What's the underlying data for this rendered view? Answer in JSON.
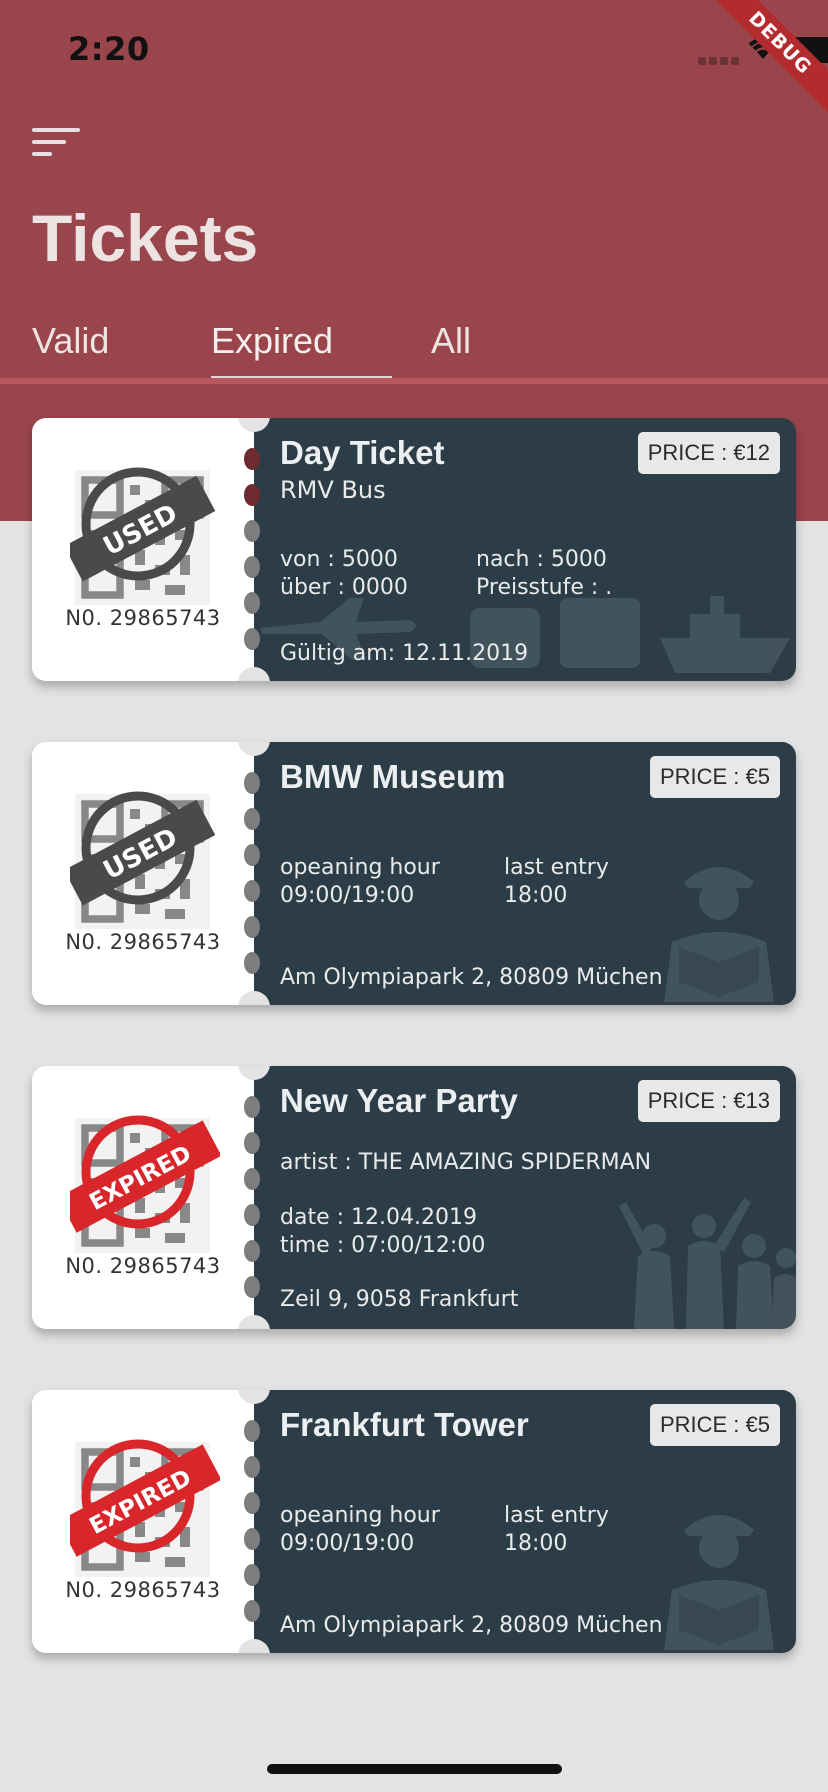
{
  "status": {
    "time": "2:20",
    "debug_label": "DEBUG"
  },
  "header": {
    "title": "Tickets"
  },
  "tabs": [
    {
      "label": "Valid"
    },
    {
      "label": "Expired"
    },
    {
      "label": "All"
    }
  ],
  "active_tab": "Expired",
  "tickets": [
    {
      "stamp": "USED",
      "number": "N0. 29865743",
      "title": "Day Ticket",
      "subtitle": "RMV Bus",
      "price": "PRICE : €12",
      "col1": [
        "von : 5000",
        "über : 0000"
      ],
      "col2": [
        "nach : 5000",
        "Preisstufe : ."
      ],
      "footer": "Gültig am: 12.11.2019"
    },
    {
      "stamp": "USED",
      "number": "N0. 29865743",
      "title": "BMW Museum",
      "price": "PRICE : €5",
      "col1": [
        "opeaning hour",
        "09:00/19:00"
      ],
      "col2": [
        "last entry",
        "18:00"
      ],
      "footer": "Am Olympiapark 2, 80809 Müchen"
    },
    {
      "stamp": "EXPIRED",
      "number": "N0. 29865743",
      "title": "New Year Party",
      "subtitle": "artist : THE AMAZING SPIDERMAN",
      "price": "PRICE : €13",
      "col1": [
        "date : 12.04.2019",
        "time : 07:00/12:00"
      ],
      "footer": "Zeil 9, 9058 Frankfurt"
    },
    {
      "stamp": "EXPIRED",
      "number": "N0. 29865743",
      "title": "Frankfurt Tower",
      "price": "PRICE : €5",
      "col1": [
        "opeaning hour",
        "09:00/19:00"
      ],
      "col2": [
        "last entry",
        "18:00"
      ],
      "footer": "Am Olympiapark 2, 80809 Müchen"
    }
  ],
  "colors": {
    "header": "#99454b",
    "ticket_body": "#2d3d47",
    "used_stamp": "#4a4a4a",
    "expired_stamp": "#d8262a"
  }
}
